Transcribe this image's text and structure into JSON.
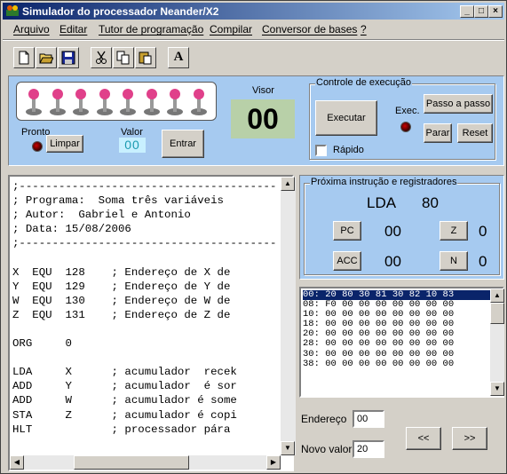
{
  "window": {
    "title": "Simulador do processador Neander/X2"
  },
  "menu": [
    "Arquivo",
    "Editar",
    "Tutor de programação",
    "Compilar",
    "Conversor de bases",
    "?"
  ],
  "toolbar": {
    "icons": [
      "new-file-icon",
      "open-folder-icon",
      "save-icon",
      "cut-icon",
      "copy-icon",
      "paste-icon",
      "font-icon"
    ],
    "font_label": "A"
  },
  "switches": {
    "count": 8
  },
  "display": {
    "visor_label": "Visor",
    "visor_value": "00",
    "pronto_label": "Pronto",
    "limpar_label": "Limpar",
    "valor_label": "Valor",
    "valor_value": "00",
    "entrar_label": "Entrar"
  },
  "execution": {
    "title": "Controle de execução",
    "executar_label": "Executar",
    "exec_label": "Exec.",
    "passo_label": "Passo a passo",
    "parar_label": "Parar",
    "reset_label": "Reset",
    "rapido_label": "Rápido"
  },
  "editor": {
    "lines": [
      ";---------------------------------------",
      "; Programa:  Soma três variáveis",
      "; Autor:  Gabriel e Antonio",
      "; Data: 15/08/2006",
      ";---------------------------------------",
      "",
      "X  EQU  128    ; Endereço de X de",
      "Y  EQU  129    ; Endereço de Y de",
      "W  EQU  130    ; Endereço de W de",
      "Z  EQU  131    ; Endereço de Z de",
      "",
      "ORG     0",
      "",
      "LDA     X      ; acumulador  recek",
      "ADD     Y      ; acumulador  é sor",
      "ADD     W      ; acumulador é some",
      "STA     Z      ; acumulador é copi",
      "HLT            ; processador pára"
    ]
  },
  "registers": {
    "title": "Próxima instrução e registradores",
    "instruction": "LDA",
    "operand": "80",
    "pc_label": "PC",
    "pc_value": "00",
    "z_label": "Z",
    "z_value": "0",
    "acc_label": "ACC",
    "acc_value": "00",
    "n_label": "N",
    "n_value": "0"
  },
  "memory": {
    "rows": [
      "00: 20 80 30 81 30 82 10 83",
      "08: F0 00 00 00 00 00 00 00",
      "10: 00 00 00 00 00 00 00 00",
      "18: 00 00 00 00 00 00 00 00",
      "20: 00 00 00 00 00 00 00 00",
      "28: 00 00 00 00 00 00 00 00",
      "30: 00 00 00 00 00 00 00 00",
      "38: 00 00 00 00 00 00 00 00"
    ]
  },
  "address": {
    "endereco_label": "Endereço",
    "endereco_value": "00",
    "novo_valor_label": "Novo valor",
    "novo_valor_value": "20",
    "prev_label": "<<",
    "next_label": ">>"
  }
}
